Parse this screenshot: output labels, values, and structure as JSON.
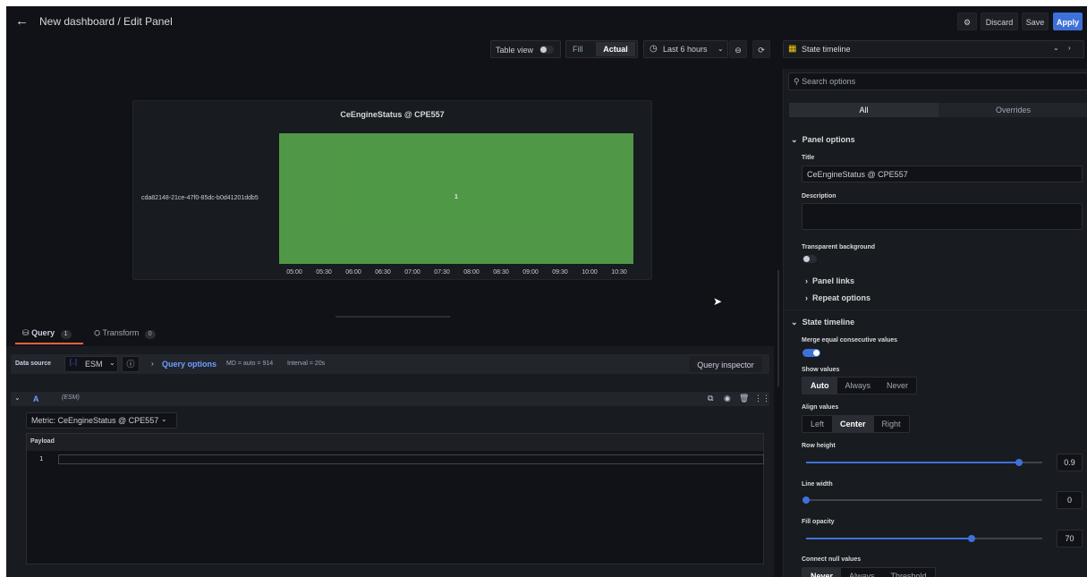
{
  "header": {
    "title": "New dashboard / Edit Panel",
    "discard_label": "Discard",
    "save_label": "Save",
    "apply_label": "Apply"
  },
  "toolbar": {
    "table_view_label": "Table view",
    "table_view_on": false,
    "fill_label": "Fill",
    "actual_label": "Actual",
    "time_range": "Last 6 hours",
    "visualization": "State timeline"
  },
  "panel": {
    "title": "CeEngineStatus @ CPE557",
    "row_label": "cda82148-21ce-47f0-85dc-b0d41201ddb5",
    "value_label": "1",
    "bar_color": "#56a64b",
    "ticks": [
      "05:00",
      "05:30",
      "06:00",
      "06:30",
      "07:00",
      "07:30",
      "08:00",
      "08:30",
      "09:00",
      "09:30",
      "10:00",
      "10:30"
    ]
  },
  "query_tabs": {
    "query_label": "Query",
    "query_count": "1",
    "transform_label": "Transform",
    "transform_count": "0"
  },
  "datasource": {
    "label": "Data source",
    "value": "ESM",
    "query_options_label": "Query options",
    "md": "MD = auto = 914",
    "interval": "Interval = 20s",
    "inspector_label": "Query inspector"
  },
  "query": {
    "ref_id": "A",
    "source": "(ESM)",
    "metric_label": "Metric: CeEngineStatus @ CPE557",
    "payload_label": "Payload",
    "line_number": "1"
  },
  "options": {
    "search_placeholder": "Search options",
    "tab_all": "All",
    "tab_overrides": "Overrides",
    "panel_options_label": "Panel options",
    "title_label": "Title",
    "title_value": "CeEngineStatus @ CPE557",
    "description_label": "Description",
    "transparent_label": "Transparent background",
    "transparent_on": false,
    "panel_links_label": "Panel links",
    "repeat_options_label": "Repeat options",
    "state_timeline_label": "State timeline",
    "merge_label": "Merge equal consecutive values",
    "merge_on": true,
    "show_values_label": "Show values",
    "show_values": [
      "Auto",
      "Always",
      "Never"
    ],
    "show_values_selected": "Auto",
    "align_values_label": "Align values",
    "align_values": [
      "Left",
      "Center",
      "Right"
    ],
    "align_values_selected": "Center",
    "row_height_label": "Row height",
    "row_height": "0.9",
    "row_height_fraction": 0.9,
    "line_width_label": "Line width",
    "line_width": "0",
    "line_width_fraction": 0,
    "fill_opacity_label": "Fill opacity",
    "fill_opacity": "70",
    "fill_opacity_fraction": 0.7,
    "connect_null_label": "Connect null values",
    "connect_null": [
      "Never",
      "Always",
      "Threshold"
    ],
    "connect_null_selected": "Never"
  },
  "colors": {
    "accent": "#3d71d9",
    "tab_active": "#f55f3e",
    "state_green": "#56a64b"
  }
}
